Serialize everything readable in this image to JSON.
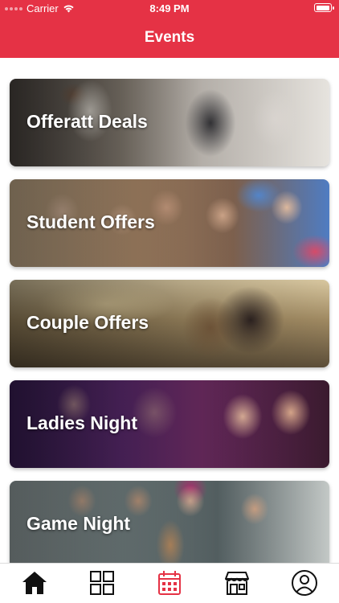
{
  "status_bar": {
    "carrier": "Carrier",
    "time": "8:49 PM"
  },
  "header": {
    "title": "Events"
  },
  "events": [
    {
      "label": "Offeratt Deals",
      "photo": "business-handshake"
    },
    {
      "label": "Student Offers",
      "photo": "students-thumbs-up"
    },
    {
      "label": "Couple Offers",
      "photo": "couple-embrace"
    },
    {
      "label": "Ladies Night",
      "photo": "women-party"
    },
    {
      "label": "Game Night",
      "photo": "friends-board-game"
    }
  ],
  "tab_bar": {
    "items": [
      {
        "icon": "home-icon",
        "active": false
      },
      {
        "icon": "grid-icon",
        "active": false
      },
      {
        "icon": "calendar-icon",
        "active": true
      },
      {
        "icon": "store-icon",
        "active": false
      },
      {
        "icon": "profile-icon",
        "active": false
      }
    ]
  },
  "colors": {
    "accent": "#e53245",
    "tab_active": "#e53245",
    "tab_inactive": "#111111"
  }
}
